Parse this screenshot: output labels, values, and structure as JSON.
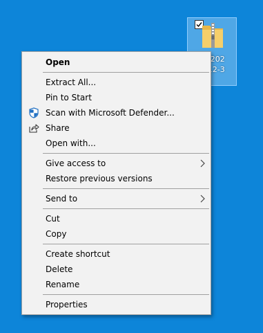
{
  "desktop": {
    "background": "#0d85d9",
    "file_icon": {
      "icon": "zip-folder-icon",
      "label_lines": [
        "ot_202",
        "2_12-3"
      ],
      "checked": true
    }
  },
  "menu": {
    "groups": [
      [
        {
          "label": "Open",
          "bold": true
        }
      ],
      [
        {
          "label": "Extract All..."
        },
        {
          "label": "Pin to Start"
        },
        {
          "label": "Scan with Microsoft Defender...",
          "icon": "defender-shield-icon"
        },
        {
          "label": "Share",
          "icon": "share-icon"
        },
        {
          "label": "Open with..."
        }
      ],
      [
        {
          "label": "Give access to",
          "submenu": true
        },
        {
          "label": "Restore previous versions"
        }
      ],
      [
        {
          "label": "Send to",
          "submenu": true
        }
      ],
      [
        {
          "label": "Cut"
        },
        {
          "label": "Copy"
        }
      ],
      [
        {
          "label": "Create shortcut"
        },
        {
          "label": "Delete"
        },
        {
          "label": "Rename"
        }
      ],
      [
        {
          "label": "Properties"
        }
      ]
    ]
  }
}
